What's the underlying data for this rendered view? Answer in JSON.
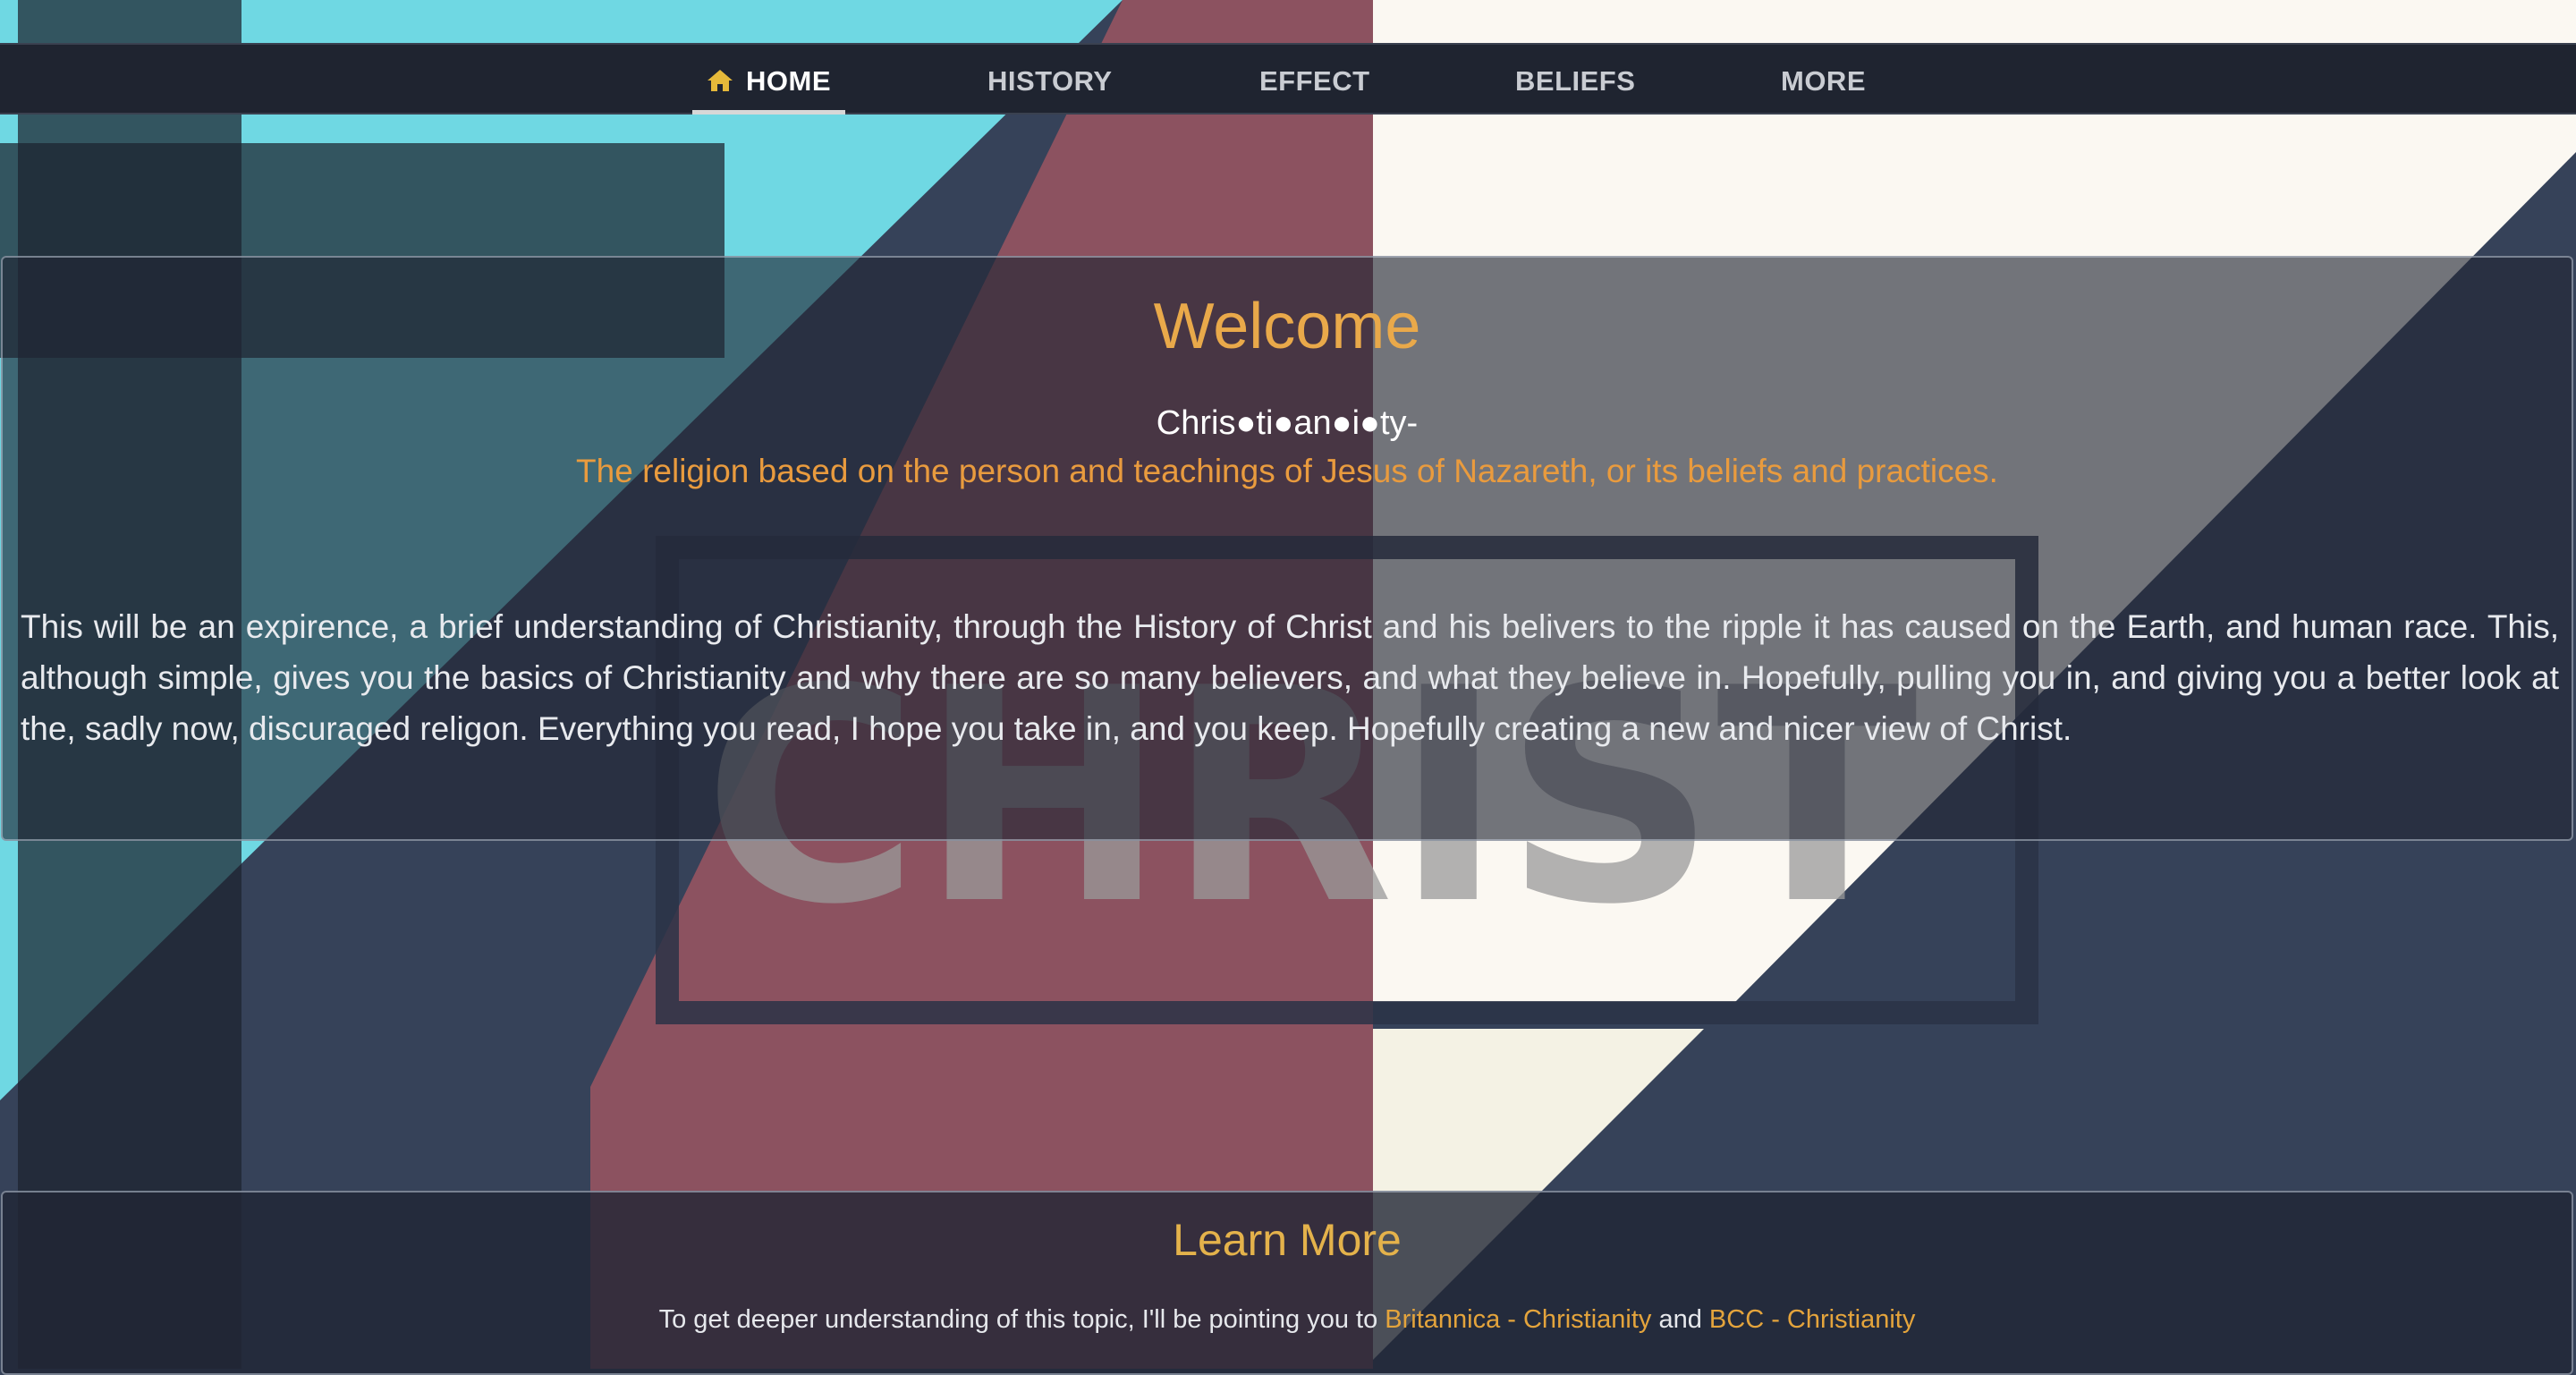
{
  "nav": {
    "items": [
      {
        "label": "HOME",
        "active": true,
        "icon": "home-icon"
      },
      {
        "label": "HISTORY",
        "active": false
      },
      {
        "label": "EFFECT",
        "active": false
      },
      {
        "label": "BELIEFS",
        "active": false
      },
      {
        "label": "MORE",
        "active": false
      }
    ]
  },
  "background": {
    "watermark_text": "CHRIST"
  },
  "welcome": {
    "title": "Welcome",
    "pronunciation": "Chris●ti●an●i●ty-",
    "definition": "The religion based on the person and teachings of Jesus of Nazareth, or its beliefs and practices.",
    "intro": "This will be an expirence, a brief understanding of Christianity, through the History of Christ and his belivers to the ripple it has caused on the Earth, and human race. This, although simple, gives you the basics of Christianity and why there are so many believers, and what they believe in. Hopefully, pulling you in, and giving you a better look at the, sadly now, discuraged religon. Everything you read, I hope you take in, and you keep. Hopefully creating a new and nicer view of Christ."
  },
  "learn_more": {
    "title": "Learn More",
    "text_before": "To get deeper understanding of this topic, I'll be pointing you to ",
    "link1": "Britannica - Christianity",
    "text_between": " and ",
    "link2": "BCC - Christianity"
  },
  "colors": {
    "navbar": "#1f2430",
    "accent_gold": "#e9a94a",
    "cyan": "#6fd8e3",
    "crimson": "#8c5260",
    "navy": "#364259",
    "cream": "#f6f3e6"
  }
}
